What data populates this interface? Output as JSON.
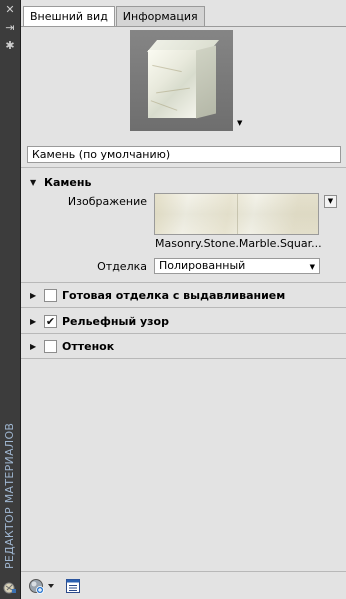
{
  "side_strip": {
    "title": "РЕДАКТОР МАТЕРИАЛОВ",
    "close_icon": "close-icon",
    "pin_icon": "pin-icon",
    "settings_icon": "settings-icon"
  },
  "tabs": [
    {
      "label": "Внешний вид",
      "active": true
    },
    {
      "label": "Информация",
      "active": false
    }
  ],
  "material_name": "Камень (по умолчанию)",
  "sections": {
    "stone": {
      "title": "Камень",
      "image_label": "Изображение",
      "image_file": "Masonry.Stone.Marble.Squar...",
      "finish_label": "Отделка",
      "finish_value": "Полированный"
    },
    "relief_finish": {
      "title": "Готовая отделка с выдавливанием",
      "checked": false
    },
    "bump_pattern": {
      "title": "Рельефный узор",
      "checked": true
    },
    "tint": {
      "title": "Оттенок",
      "checked": false
    }
  },
  "colors": {
    "strip": "#3c3c3c",
    "panel": "#e3e3e3",
    "vertical_title": "#9fb6d0"
  }
}
